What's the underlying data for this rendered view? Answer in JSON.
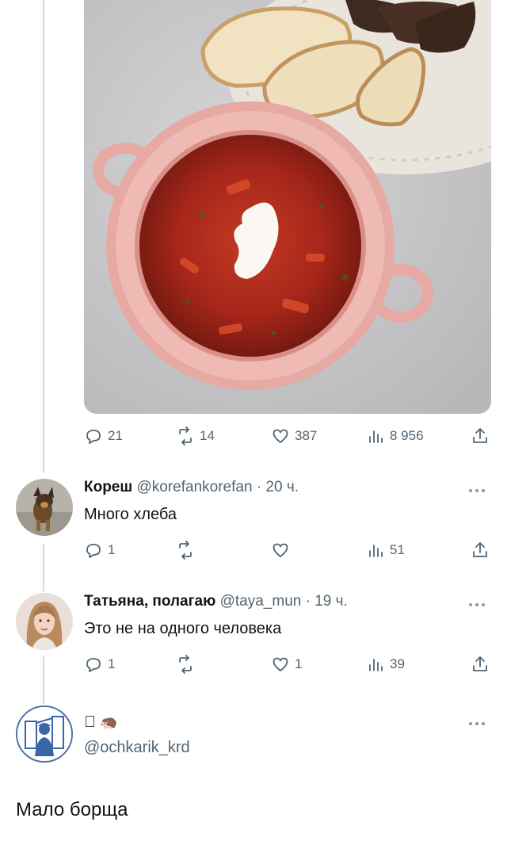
{
  "post": {
    "image_alt": "bowl of borscht with sour cream and bread",
    "stats": {
      "replies": "21",
      "reposts": "14",
      "likes": "387",
      "views": "8 956"
    }
  },
  "replies": [
    {
      "name": "Кореш",
      "handle": "@korefankorefan",
      "time": "· 20 ч.",
      "text": "Много хлеба",
      "replies": "1",
      "reposts": "",
      "likes": "",
      "views": "51"
    },
    {
      "name": "Татьяна, полагаю",
      "handle": "@taya_mun",
      "time": "· 19 ч.",
      "text": "Это не на одного человека",
      "replies": "1",
      "reposts": "",
      "likes": "1",
      "views": "39"
    }
  ],
  "composer": {
    "name_emoji": "🦔",
    "handle": "@ochkarik_krd",
    "text": "Мало борща"
  },
  "colors": {
    "text": "#0f1419",
    "secondary": "#536471",
    "thread_line": "#cfd9de",
    "borscht": "#a6261a",
    "bowl": "#e6a9a3"
  }
}
